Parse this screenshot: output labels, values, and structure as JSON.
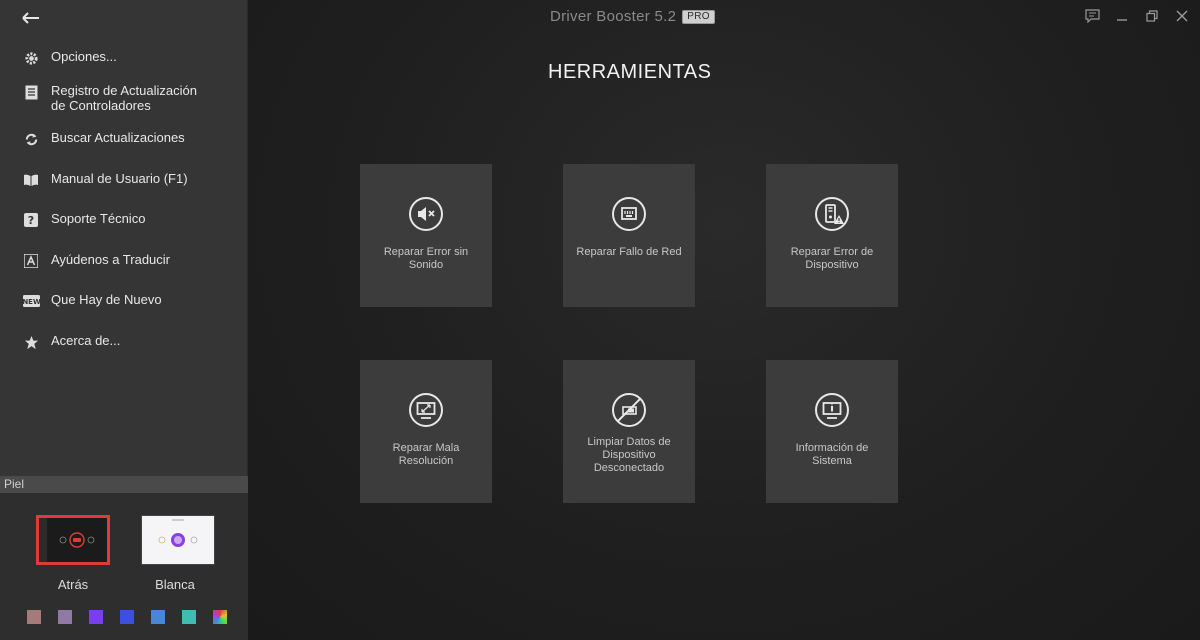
{
  "window": {
    "title": "Driver Booster 5.2",
    "badge": "PRO"
  },
  "sidebar": {
    "back_icon": "arrow-left-icon",
    "items": [
      {
        "label": "Opciones...",
        "icon": "gear-icon"
      },
      {
        "label": "Registro de Actualización de Controladores",
        "icon": "log-icon"
      },
      {
        "label": "Buscar Actualizaciones",
        "icon": "refresh-icon"
      },
      {
        "label": "Manual de Usuario (F1)",
        "icon": "book-icon"
      },
      {
        "label": "Soporte Técnico",
        "icon": "help-icon"
      },
      {
        "label": "Ayúdenos a Traducir",
        "icon": "translate-icon"
      },
      {
        "label": "Que Hay de Nuevo",
        "icon": "new-icon"
      },
      {
        "label": "Acerca de...",
        "icon": "star-icon"
      }
    ]
  },
  "skin": {
    "header": "Piel",
    "options": [
      {
        "label": "Atrás",
        "selected": true
      },
      {
        "label": "Blanca",
        "selected": false
      }
    ],
    "swatches": [
      "#a67a7a",
      "#8f7aa6",
      "#7a3df0",
      "#3d4fe0",
      "#4a86d8",
      "#3fbdb5",
      "multicolor"
    ]
  },
  "main": {
    "title": "HERRAMIENTAS",
    "tools": [
      {
        "label": "Reparar Error sin Sonido",
        "icon": "speaker-mute-icon"
      },
      {
        "label": "Reparar Fallo de Red",
        "icon": "network-port-icon"
      },
      {
        "label": "Reparar Error de Dispositivo",
        "icon": "device-warning-icon"
      },
      {
        "label": "Reparar Mala Resolución",
        "icon": "monitor-resolution-icon"
      },
      {
        "label": "Limpiar Datos de Dispositivo Desconectado",
        "icon": "device-clean-icon"
      },
      {
        "label": "Información de Sistema",
        "icon": "system-info-icon"
      }
    ]
  },
  "colors": {
    "accent_selected": "#e03b3b",
    "tile_bg": "#3c3c3c",
    "sidebar_bg": "#353535"
  }
}
